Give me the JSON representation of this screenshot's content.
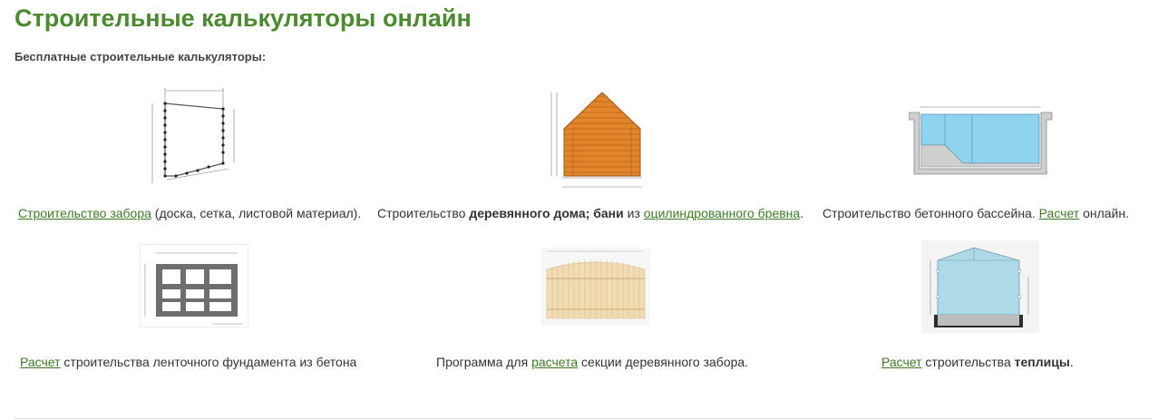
{
  "page": {
    "title": "Строительные калькуляторы онлайн",
    "subtitle": "Бесплатные строительные калькуляторы:"
  },
  "calculators": [
    {
      "id": "fence",
      "thumb_icon": "fence-plan-diagram",
      "link": "Строительство забора",
      "text_after": " (доска, сетка, листовой материал)."
    },
    {
      "id": "wooden-house",
      "thumb_icon": "log-house-diagram",
      "text_before": "Строительство ",
      "bold": "деревянного дома; бани",
      "text_mid": " из ",
      "link": "оцилиндрованного бревна",
      "text_after": "."
    },
    {
      "id": "pool",
      "thumb_icon": "pool-section-diagram",
      "text_before": "Строительство бетонного бассейна. ",
      "link": "Расчет",
      "text_after": " онлайн."
    },
    {
      "id": "strip-foundation",
      "thumb_icon": "foundation-plan-diagram",
      "link": "Расчет",
      "text_after": " строительства ленточного фундамента из бетона"
    },
    {
      "id": "wooden-fence-section",
      "thumb_icon": "picket-fence-diagram",
      "text_before": "Программа для ",
      "link": "расчета",
      "text_after": " секции деревянного забора."
    },
    {
      "id": "greenhouse",
      "thumb_icon": "greenhouse-diagram",
      "link": "Расчет",
      "text_mid": " строительства ",
      "bold": "теплицы",
      "text_after": "."
    }
  ],
  "colors": {
    "title_green": "#4b8a2f",
    "link_green": "#3d7a25",
    "wood_orange": "#e3852a",
    "pool_blue": "#8fd3ee",
    "greenhouse_blue": "#aed9e6",
    "picket_beige": "#f2dcb4"
  }
}
